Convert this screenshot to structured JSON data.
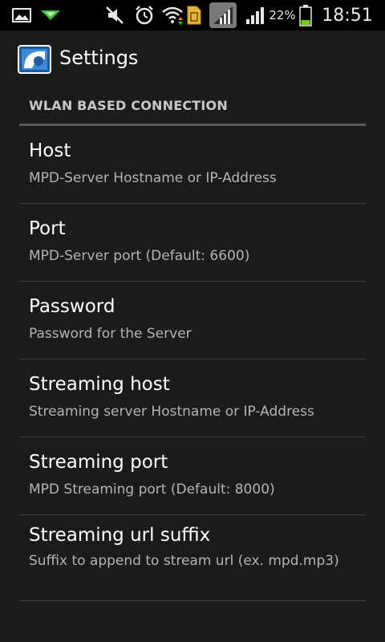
{
  "status_bar": {
    "battery_percent": "22%",
    "time": "18:51",
    "icons": [
      "gallery-icon",
      "notification-icon",
      "mute-icon",
      "alarm-icon",
      "wifi-icon",
      "sim-icon",
      "signal-icon",
      "signal-icon",
      "battery-icon"
    ]
  },
  "header": {
    "title": "Settings",
    "icon": "app-icon"
  },
  "section": {
    "label": "WLAN BASED CONNECTION"
  },
  "preferences": [
    {
      "title": "Host",
      "summary": "MPD-Server Hostname or IP-Address"
    },
    {
      "title": "Port",
      "summary": "MPD-Server port (Default: 6600)"
    },
    {
      "title": "Password",
      "summary": "Password for the Server"
    },
    {
      "title": "Streaming host",
      "summary": "Streaming server Hostname or IP-Address"
    },
    {
      "title": "Streaming port",
      "summary": "MPD Streaming port (Default: 8000)"
    },
    {
      "title": "Streaming url suffix",
      "summary": "Suffix to append to stream url (ex. mpd.mp3)"
    }
  ],
  "colors": {
    "background": "#1b1b1b",
    "status_bar": "#000000",
    "battery_fill": "#6ecb1f"
  }
}
